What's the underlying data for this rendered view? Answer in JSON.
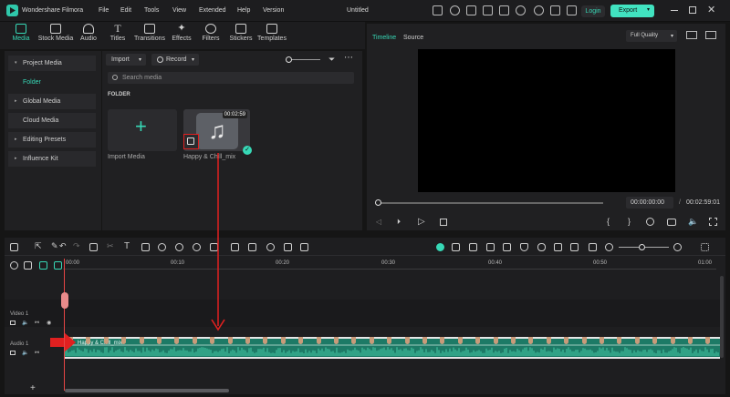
{
  "app": {
    "title": "Wondershare Filmora",
    "doc_title": "Untitled"
  },
  "menu": [
    "File",
    "Edit",
    "Tools",
    "View",
    "Extended",
    "Help",
    "Version"
  ],
  "titlebar": {
    "login_label": "Login",
    "export_label": "Export"
  },
  "tools": [
    {
      "label": "Media",
      "icon": "media-icon"
    },
    {
      "label": "Stock Media",
      "icon": "stock-media-icon"
    },
    {
      "label": "Audio",
      "icon": "audio-icon"
    },
    {
      "label": "Titles",
      "icon": "titles-icon"
    },
    {
      "label": "Transitions",
      "icon": "transitions-icon"
    },
    {
      "label": "Effects",
      "icon": "effects-icon"
    },
    {
      "label": "Filters",
      "icon": "filters-icon"
    },
    {
      "label": "Stickers",
      "icon": "stickers-icon"
    },
    {
      "label": "Templates",
      "icon": "templates-icon"
    }
  ],
  "sidebar": {
    "items": [
      {
        "label": "Project Media",
        "caret": "▾"
      },
      {
        "label": "Folder",
        "caret": ""
      },
      {
        "label": "Global Media",
        "caret": "▸"
      },
      {
        "label": "Cloud Media",
        "caret": ""
      },
      {
        "label": "Editing Presets",
        "caret": "▸"
      },
      {
        "label": "Influence Kit",
        "caret": "▸"
      }
    ]
  },
  "media": {
    "import_label": "Import",
    "record_label": "Record",
    "search_placeholder": "Search media",
    "folder_heading": "FOLDER",
    "import_tile_label": "Import Media",
    "clip_name": "Happy & Chill_mix",
    "clip_duration": "00:02:59"
  },
  "preview": {
    "tabs": [
      "Timeline",
      "Source"
    ],
    "quality": "Full Quality",
    "current_time": "00:00:00:00",
    "total_time": "00:02:59:01"
  },
  "timeline": {
    "ruler": [
      "00:00",
      "00:10",
      "00:20",
      "00:30",
      "00:40",
      "00:50",
      "01:00"
    ],
    "video_track_label": "Video 1",
    "audio_track_label": "Audio 1",
    "audio_clip_label": "Happy & Chill_mix"
  },
  "colors": {
    "accent": "#37d8b6",
    "highlight": "#e02020",
    "playhead": "#e64545",
    "export_bg": "#41e3c0"
  },
  "footer": {
    "add_track": "+"
  }
}
